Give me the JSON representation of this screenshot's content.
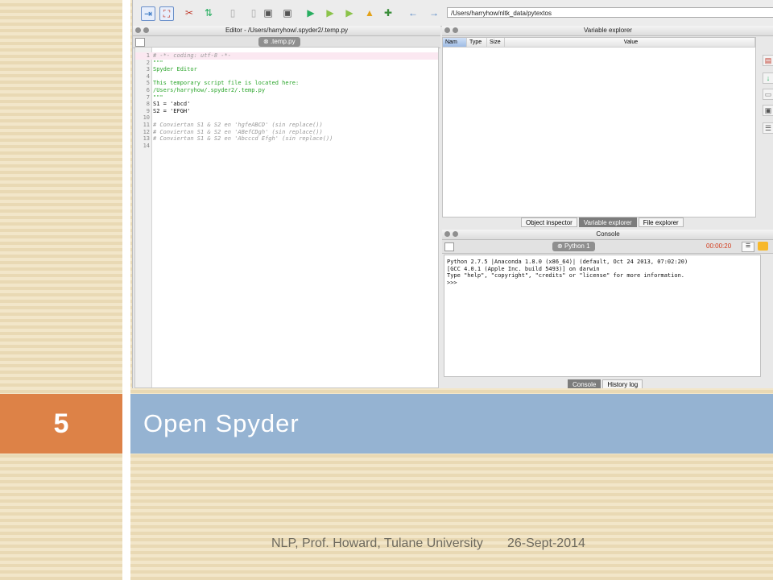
{
  "slide": {
    "number": "5",
    "title": "Open Spyder",
    "footer_left": "NLP, Prof. Howard, Tulane University",
    "footer_right": "26-Sept-2014",
    "colors": {
      "orange": "#dd8247",
      "blue": "#95b3d2",
      "background": "#efe2c4"
    }
  },
  "toolbar": {
    "path": "/Users/harryhow/nltk_data/pytextos",
    "icons": [
      "run-icon",
      "fullscreen-icon",
      "tools-icon",
      "python-path-icon",
      "new-file-icon",
      "open-file-icon",
      "save-icon",
      "save-all-icon",
      "run-file-icon",
      "run-selection-icon",
      "run-config-icon",
      "debug-icon",
      "step-icon",
      "back-arrow-icon",
      "forward-arrow-icon",
      "folder-icon",
      "python-icon"
    ]
  },
  "editor": {
    "title": "Editor - /Users/harryhow/.spyder2/.temp.py",
    "tab_label": ".temp.py",
    "lines": [
      {
        "n": "1",
        "text": "# -*- coding: utf-8 -*-",
        "style": "comment"
      },
      {
        "n": "2",
        "text": "\"\"\"",
        "style": "string"
      },
      {
        "n": "3",
        "text": "Spyder Editor",
        "style": "string"
      },
      {
        "n": "4",
        "text": "",
        "style": "string"
      },
      {
        "n": "5",
        "text": "This temporary script file is located here:",
        "style": "string"
      },
      {
        "n": "6",
        "text": "/Users/harryhow/.spyder2/.temp.py",
        "style": "string"
      },
      {
        "n": "7",
        "text": "\"\"\"",
        "style": "string"
      },
      {
        "n": "8",
        "text": "S1 = 'abcd'",
        "style": "plain"
      },
      {
        "n": "9",
        "text": "S2 = 'EFGH'",
        "style": "plain"
      },
      {
        "n": "10",
        "text": "",
        "style": "plain"
      },
      {
        "n": "11",
        "text": "# Conviertan S1 & S2 en 'hgfeABCD' (sin replace())",
        "style": "comment"
      },
      {
        "n": "12",
        "text": "# Conviertan S1 & S2 en 'ABefCDgh' (sin replace())",
        "style": "comment"
      },
      {
        "n": "13",
        "text": "# Conviertan S1 & S2 en 'Abcccd Efgh' (sin replace())",
        "style": "comment"
      },
      {
        "n": "14",
        "text": "",
        "style": "plain"
      }
    ]
  },
  "variable_explorer": {
    "title": "Variable explorer",
    "columns": [
      "Nam",
      "Type",
      "Size",
      "Value"
    ],
    "tabs": [
      "Object inspector",
      "Variable explorer",
      "File explorer"
    ],
    "active_tab": 1
  },
  "console": {
    "title": "Console",
    "tab_label": "Python 1",
    "timer": "00:00:20",
    "output": "Python 2.7.5 |Anaconda 1.8.0 (x86_64)| (default, Oct 24 2013, 07:02:20)\n[GCC 4.0.1 (Apple Inc. build 5493)] on darwin\nType \"help\", \"copyright\", \"credits\" or \"license\" for more information.\n>>>",
    "tabs": [
      "Console",
      "History log"
    ],
    "active_tab": 0
  }
}
